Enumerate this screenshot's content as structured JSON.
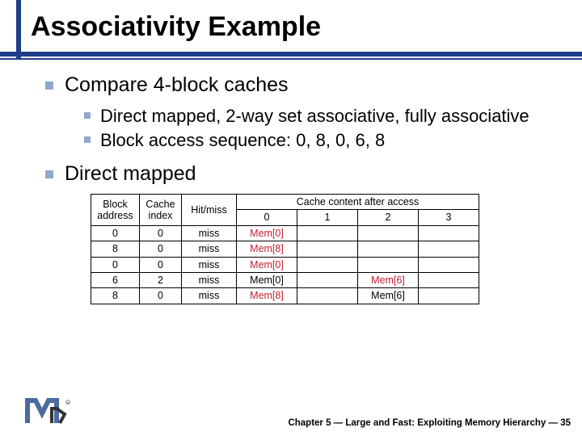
{
  "title": "Associativity Example",
  "bullets": {
    "main1": "Compare 4-block caches",
    "sub1a": "Direct mapped, 2-way set associative, fully associative",
    "sub1b": "Block access sequence: 0, 8, 0, 6, 8",
    "main2": "Direct mapped"
  },
  "table": {
    "hdr_block": "Block address",
    "hdr_index": "Cache index",
    "hdr_hit": "Hit/miss",
    "hdr_cache": "Cache content after access",
    "col0": "0",
    "col1": "1",
    "col2": "2",
    "col3": "3",
    "rows": [
      {
        "addr": "0",
        "idx": "0",
        "hm": "miss",
        "c0": "Mem[0]",
        "c0_red": true,
        "c1": "",
        "c2": "",
        "c3": ""
      },
      {
        "addr": "8",
        "idx": "0",
        "hm": "miss",
        "c0": "Mem[8]",
        "c0_red": true,
        "c1": "",
        "c2": "",
        "c3": ""
      },
      {
        "addr": "0",
        "idx": "0",
        "hm": "miss",
        "c0": "Mem[0]",
        "c0_red": true,
        "c1": "",
        "c2": "",
        "c3": ""
      },
      {
        "addr": "6",
        "idx": "2",
        "hm": "miss",
        "c0": "Mem[0]",
        "c0_red": false,
        "c1": "",
        "c2": "Mem[6]",
        "c2_red": true,
        "c3": ""
      },
      {
        "addr": "8",
        "idx": "0",
        "hm": "miss",
        "c0": "Mem[8]",
        "c0_red": true,
        "c1": "",
        "c2": "Mem[6]",
        "c2_red": false,
        "c3": ""
      }
    ]
  },
  "footer": "Chapter 5 — Large and Fast: Exploiting Memory Hierarchy — 35"
}
